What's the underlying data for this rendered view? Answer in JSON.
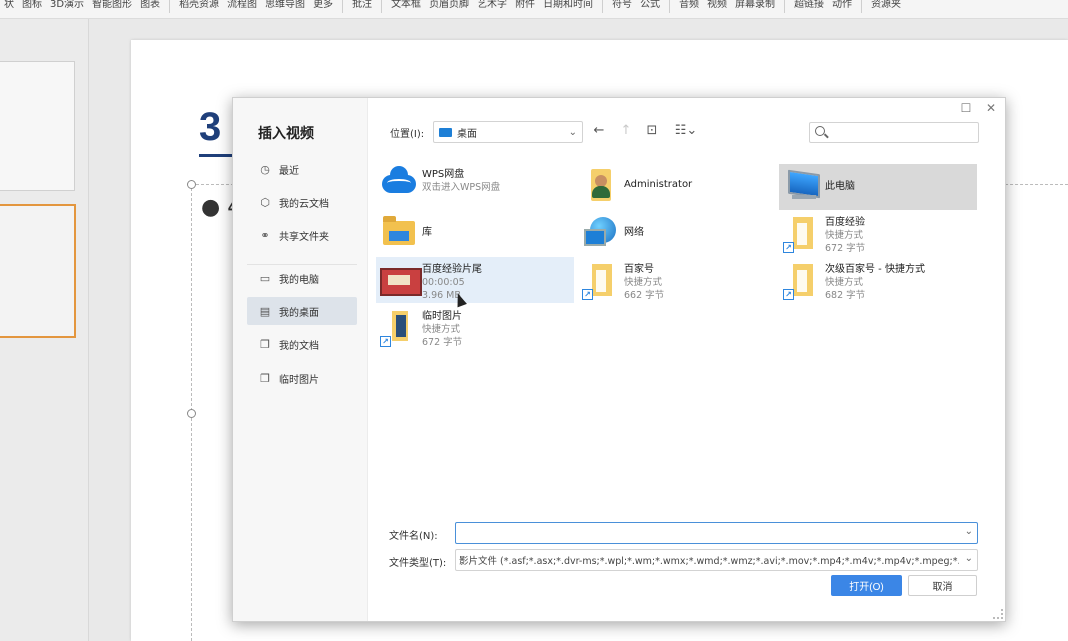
{
  "ribbon": {
    "items": [
      "状",
      "图标",
      "3D演示",
      "智能图形",
      "图表",
      "稻壳资源",
      "流程图",
      "思维导图",
      "更多",
      "批注",
      "文本框",
      "页眉页脚",
      "艺术字",
      "附件",
      "日期和时间",
      "符号",
      "公式",
      "音频",
      "视频",
      "屏幕录制",
      "超链接",
      "动作",
      "资源夹"
    ]
  },
  "slide": {
    "title_fragment": "3",
    "bullet_fragment": "4"
  },
  "dialog": {
    "title": "插入视频",
    "nav": [
      {
        "label": "最近",
        "icon": "clock-icon"
      },
      {
        "label": "我的云文档",
        "icon": "cloud-doc-icon"
      },
      {
        "label": "共享文件夹",
        "icon": "share-icon"
      },
      {
        "label": "我的电脑",
        "icon": "monitor-icon"
      },
      {
        "label": "我的桌面",
        "icon": "desktop-icon"
      },
      {
        "label": "我的文档",
        "icon": "documents-icon"
      },
      {
        "label": "临时图片",
        "icon": "image-folder-icon"
      }
    ],
    "location_label": "位置(I):",
    "location_value": "桌面",
    "search_placeholder": "",
    "files": [
      {
        "name": "WPS网盘",
        "sub1": "双击进入WPS网盘",
        "sub2": ""
      },
      {
        "name": "Administrator",
        "sub1": "",
        "sub2": ""
      },
      {
        "name": "此电脑",
        "sub1": "",
        "sub2": ""
      },
      {
        "name": "库",
        "sub1": "",
        "sub2": ""
      },
      {
        "name": "网络",
        "sub1": "",
        "sub2": ""
      },
      {
        "name": "百度经验",
        "sub1": "快捷方式",
        "sub2": "672 字节"
      },
      {
        "name": "百度经验片尾",
        "sub1": "00:00:05",
        "sub2": "3.96 MB"
      },
      {
        "name": "百家号",
        "sub1": "快捷方式",
        "sub2": "662 字节"
      },
      {
        "name": "次级百家号 - 快捷方式",
        "sub1": "快捷方式",
        "sub2": "682 字节"
      },
      {
        "name": "临时图片",
        "sub1": "快捷方式",
        "sub2": "672 字节"
      }
    ],
    "filename_label": "文件名(N):",
    "filename_value": "",
    "filetype_label": "文件类型(T):",
    "filetype_value": "影片文件 (*.asf;*.asx;*.dvr-ms;*.wpl;*.wm;*.wmx;*.wmd;*.wmz;*.avi;*.mov;*.mp4;*.m4v;*.mp4v;*.mpeg;*.mpg;*.m",
    "open_button": "打开(O)",
    "cancel_button": "取消"
  }
}
